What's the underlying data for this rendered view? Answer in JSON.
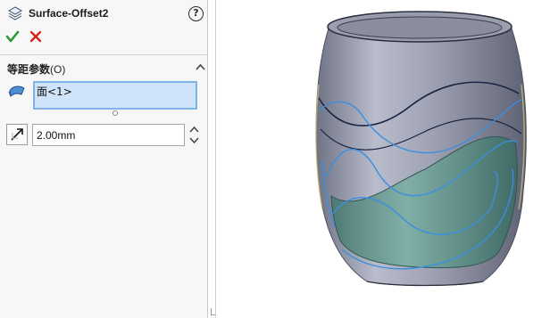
{
  "panel": {
    "title": "Surface-Offset2",
    "help_glyph": "?",
    "ok_icon": "checkmark-icon",
    "cancel_icon": "close-icon",
    "group": {
      "title": "等距参数",
      "count": "(O)",
      "collapse_icon": "chevron-up-icon"
    },
    "selection": {
      "icon": "face-select-icon",
      "items": [
        "面<1>"
      ]
    },
    "distance": {
      "reverse_icon": "reverse-direction-icon",
      "value": "2.00mm"
    }
  },
  "colors": {
    "accept": "#2f9a2f",
    "cancel": "#d0261a",
    "selection_fill": "#cfe3fa",
    "selection_border": "#7fb3e6",
    "model_body": "#8f93a5",
    "offset_surface": "#5f8f86",
    "curve_highlight": "#3a8fe0"
  }
}
